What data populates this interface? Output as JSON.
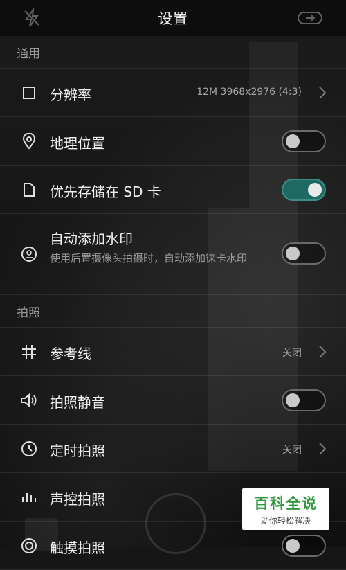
{
  "header": {
    "title": "设置",
    "left_icon": "flash-off-icon",
    "right_icon": "switch-camera-icon"
  },
  "sections": {
    "general": "通用",
    "photo": "拍照"
  },
  "rows": {
    "resolution": {
      "label": "分辨率",
      "value": "12M 3968x2976 (4:3)",
      "icon": "square-icon"
    },
    "location": {
      "label": "地理位置",
      "icon": "location-pin-icon",
      "toggle": false
    },
    "sd_storage": {
      "label": "优先存储在 SD 卡",
      "icon": "document-icon",
      "toggle": true
    },
    "watermark": {
      "label": "自动添加水印",
      "desc": "使用后置摄像头拍摄时，自动添加徕卡水印",
      "icon": "stamp-icon",
      "toggle": false
    },
    "gridlines": {
      "label": "参考线",
      "value": "关闭",
      "icon": "grid-icon"
    },
    "mute": {
      "label": "拍照静音",
      "icon": "speaker-icon",
      "toggle": false
    },
    "timer": {
      "label": "定时拍照",
      "value": "关闭",
      "icon": "clock-icon"
    },
    "voice": {
      "label": "声控拍照",
      "icon": "audio-bars-icon"
    },
    "touch": {
      "label": "触摸拍照",
      "icon": "touch-circle-icon",
      "toggle": false
    }
  },
  "watermark_badge": {
    "title": "百科全说",
    "subtitle": "助你轻松解决"
  },
  "colors": {
    "toggle_on": "#1e6a63",
    "background": "#161616",
    "badge_green": "#2e9a3c"
  }
}
